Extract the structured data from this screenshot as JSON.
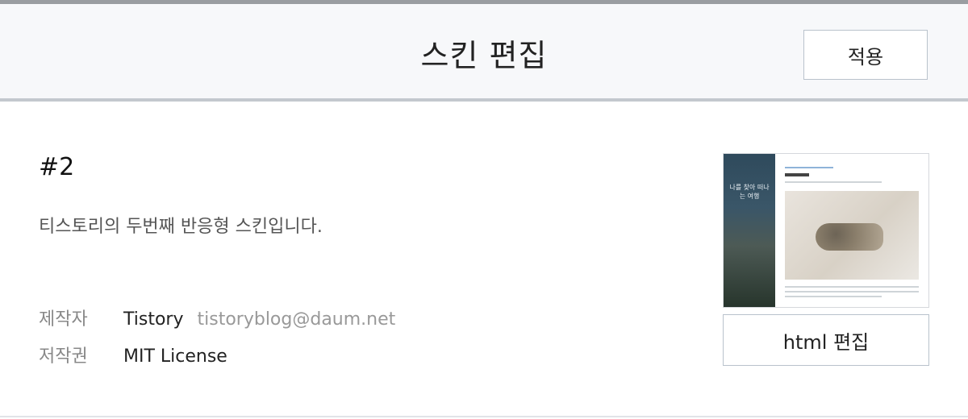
{
  "header": {
    "title": "스킨 편집",
    "apply_label": "적용"
  },
  "skin": {
    "number": "#2",
    "description": "티스토리의 두번째 반응형 스킨입니다.",
    "creator_label": "제작자",
    "creator_name": "Tistory",
    "creator_email": "tistoryblog@daum.net",
    "license_label": "저작권",
    "license_value": "MIT License"
  },
  "preview": {
    "left_text": "나를 찾아 떠나는 여행",
    "edit_html_label": "html 편집"
  }
}
